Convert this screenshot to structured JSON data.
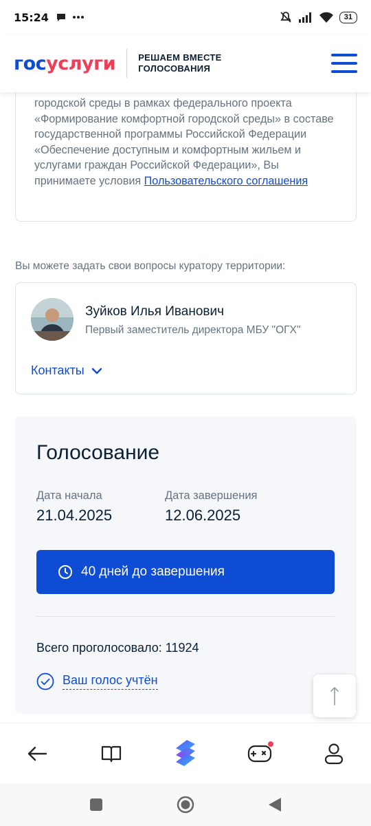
{
  "status_bar": {
    "time": "15:24",
    "battery": "31",
    "icons": [
      "chat-bubble-icon",
      "more-dots-icon",
      "mute-icon",
      "signal-icon",
      "wifi-icon",
      "battery-icon"
    ]
  },
  "header": {
    "logo_part1": "гос",
    "logo_part2": "услуги",
    "tagline_line1": "РЕШАЕМ ВМЕСТЕ",
    "tagline_line2": "ГОЛОСОВАНИЯ",
    "menu_icon": "hamburger-menu-icon"
  },
  "agreement": {
    "text": "городской среды в рамках федерального проекта «Формирование комфортной городской среды» в составе государственной программы Российской Федерации «Обеспечение доступным и комфортным жильем и услугами граждан Российской Федерации», Вы принимаете условия ",
    "link": "Пользовательского соглашения"
  },
  "curator": {
    "label": "Вы можете задать свои вопросы куратору территории:",
    "name": "Зуйков Илья Иванович",
    "role": "Первый заместитель директора МБУ \"ОГХ\"",
    "contacts_label": "Контакты"
  },
  "voting": {
    "title": "Голосование",
    "start_label": "Дата начала",
    "start_date": "21.04.2025",
    "end_label": "Дата завершения",
    "end_date": "12.06.2025",
    "deadline_text": "40 дней до завершения",
    "total_votes": "Всего проголосовало: 11924",
    "voted_status": "Ваш голос учтён"
  },
  "colors": {
    "primary": "#0d4cd3",
    "logo_red": "#ee3f58",
    "text_dark": "#0b1f33",
    "text_muted": "#66727f",
    "card_bg": "#f5f7fa"
  },
  "browser_nav": [
    "back-arrow-icon",
    "book-icon",
    "browser-logo-icon",
    "gamepad-icon",
    "profile-icon"
  ],
  "android_nav": [
    "recents-square-icon",
    "home-circle-icon",
    "back-triangle-icon"
  ]
}
